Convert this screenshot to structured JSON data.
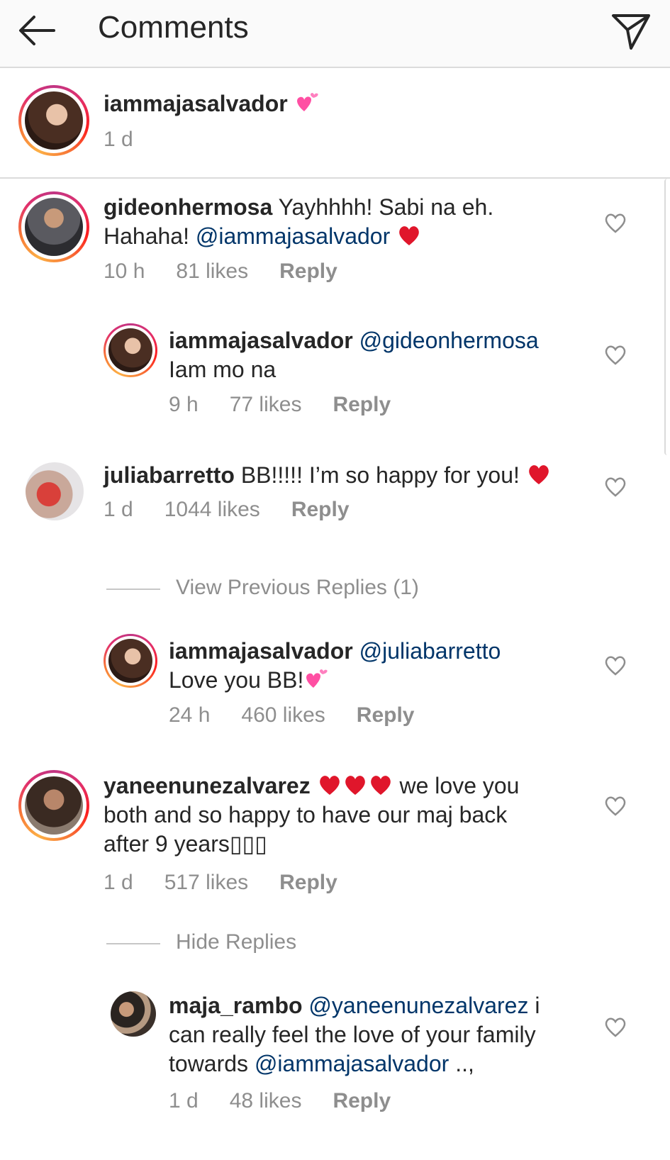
{
  "header": {
    "title": "Comments",
    "back_icon": "back-arrow-icon",
    "send_icon": "direct-send-icon"
  },
  "caption": {
    "username": "iammajasalvador",
    "time": "1 d"
  },
  "comments": [
    {
      "username": "gideonhermosa",
      "line1": "Yayhhhh! Sabi na eh.",
      "line2_prefix": "Hahaha! ",
      "mention": "@iammajasalvador",
      "time": "10 h",
      "likes": "81 likes",
      "reply": "Reply"
    },
    {
      "username": "iammajasalvador",
      "mention": "@gideonhermosa",
      "line2": "Iam mo na",
      "time": "9 h",
      "likes": "77 likes",
      "reply": "Reply"
    },
    {
      "username": "juliabarretto",
      "text": "BB!!!!! I’m so happy for you!",
      "time": "1 d",
      "likes": "1044 likes",
      "reply": "Reply"
    },
    {
      "username": "iammajasalvador",
      "mention": "@juliabarretto",
      "line2": "Love you BB!",
      "time": "24 h",
      "likes": "460 likes",
      "reply": "Reply"
    },
    {
      "username": "yaneenunezalvarez",
      "line1_suffix": " we love you",
      "line2": "both and so happy to have our maj back",
      "line3": "after 9 years▯▯▯",
      "time": "1 d",
      "likes": "517 likes",
      "reply": "Reply"
    },
    {
      "username": "maja_rambo",
      "mention1": "@yaneenunezalvarez",
      "line1_suffix": " i",
      "line2": "can really feel the love of your family",
      "line3_prefix": "towards ",
      "mention2": "@iammajasalvador",
      "line3_suffix": " ..,",
      "time": "1 d",
      "likes": "48 likes",
      "reply": "Reply"
    }
  ],
  "view_previous_replies": "View Previous Replies (1)",
  "hide_replies": "Hide Replies",
  "colors": {
    "mention": "#003569",
    "meta": "#8e8e8e",
    "heart_emoji": "#e0162b",
    "sparkle_emoji": "#ff4fa3"
  }
}
